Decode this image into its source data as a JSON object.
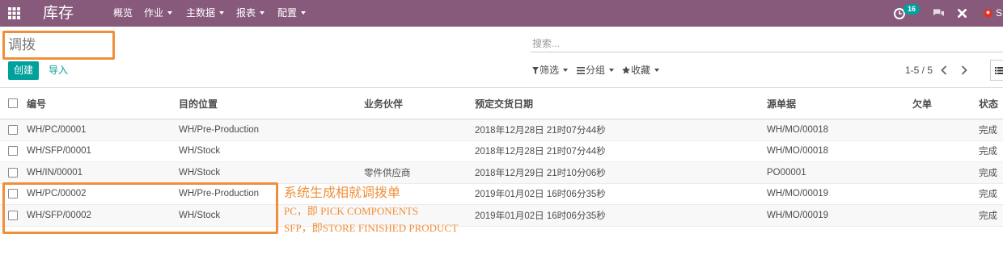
{
  "colors": {
    "navbar_bg": "#875A7B",
    "primary": "#00A09D",
    "annotation": "#EF8F3A"
  },
  "icons": {
    "apps": "apps-grid-icon",
    "activity": "activity-clock-icon",
    "chat": "chat-icon",
    "close": "close-icon",
    "avatar": "user-avatar-icon",
    "filter": "filter-funnel-icon",
    "groupby": "group-bars-icon",
    "favorites": "star-icon",
    "pager_prev": "chevron-left-icon",
    "pager_next": "chevron-right-icon",
    "view_list": "list-view-icon"
  },
  "navbar": {
    "app_title": "库存",
    "menus": [
      {
        "label": "概览"
      },
      {
        "label": "作业"
      },
      {
        "label": "主数据"
      },
      {
        "label": "报表"
      },
      {
        "label": "配置"
      }
    ],
    "activity_badge": "16",
    "user_label": "S"
  },
  "control_panel": {
    "breadcrumb": "调拨",
    "search": {
      "placeholder": "搜索..."
    },
    "create_label": "创建",
    "import_label": "导入",
    "filters_label": "筛选",
    "groupby_label": "分组",
    "favorites_label": "收藏",
    "pager": "1-5 / 5"
  },
  "table": {
    "columns": [
      "编号",
      "目的位置",
      "业务伙伴",
      "预定交货日期",
      "源单据",
      "欠单",
      "状态"
    ],
    "rows": [
      {
        "reference": "WH/PC/00001",
        "destination": "WH/Pre-Production",
        "partner": "",
        "scheduled_date": "2018年12月28日 21时07分44秒",
        "origin": "WH/MO/00018",
        "backorder": "",
        "state": "完成"
      },
      {
        "reference": "WH/SFP/00001",
        "destination": "WH/Stock",
        "partner": "",
        "scheduled_date": "2018年12月28日 21时07分44秒",
        "origin": "WH/MO/00018",
        "backorder": "",
        "state": "完成"
      },
      {
        "reference": "WH/IN/00001",
        "destination": "WH/Stock",
        "partner": "零件供应商",
        "scheduled_date": "2018年12月29日 21时10分06秒",
        "origin": "PO00001",
        "backorder": "",
        "state": "完成"
      },
      {
        "reference": "WH/PC/00002",
        "destination": "WH/Pre-Production",
        "partner": "",
        "scheduled_date": "2019年01月02日 16时06分35秒",
        "origin": "WH/MO/00019",
        "backorder": "",
        "state": "完成"
      },
      {
        "reference": "WH/SFP/00002",
        "destination": "WH/Stock",
        "partner": "",
        "scheduled_date": "2019年01月02日 16时06分35秒",
        "origin": "WH/MO/00019",
        "backorder": "",
        "state": "完成"
      }
    ]
  },
  "annotations": {
    "note_title": "系统生成相就调拨单",
    "note_pc": "PC，即 PICK COMPONENTS",
    "note_sfp": "SFP，即STORE FINISHED PRODUCT"
  }
}
